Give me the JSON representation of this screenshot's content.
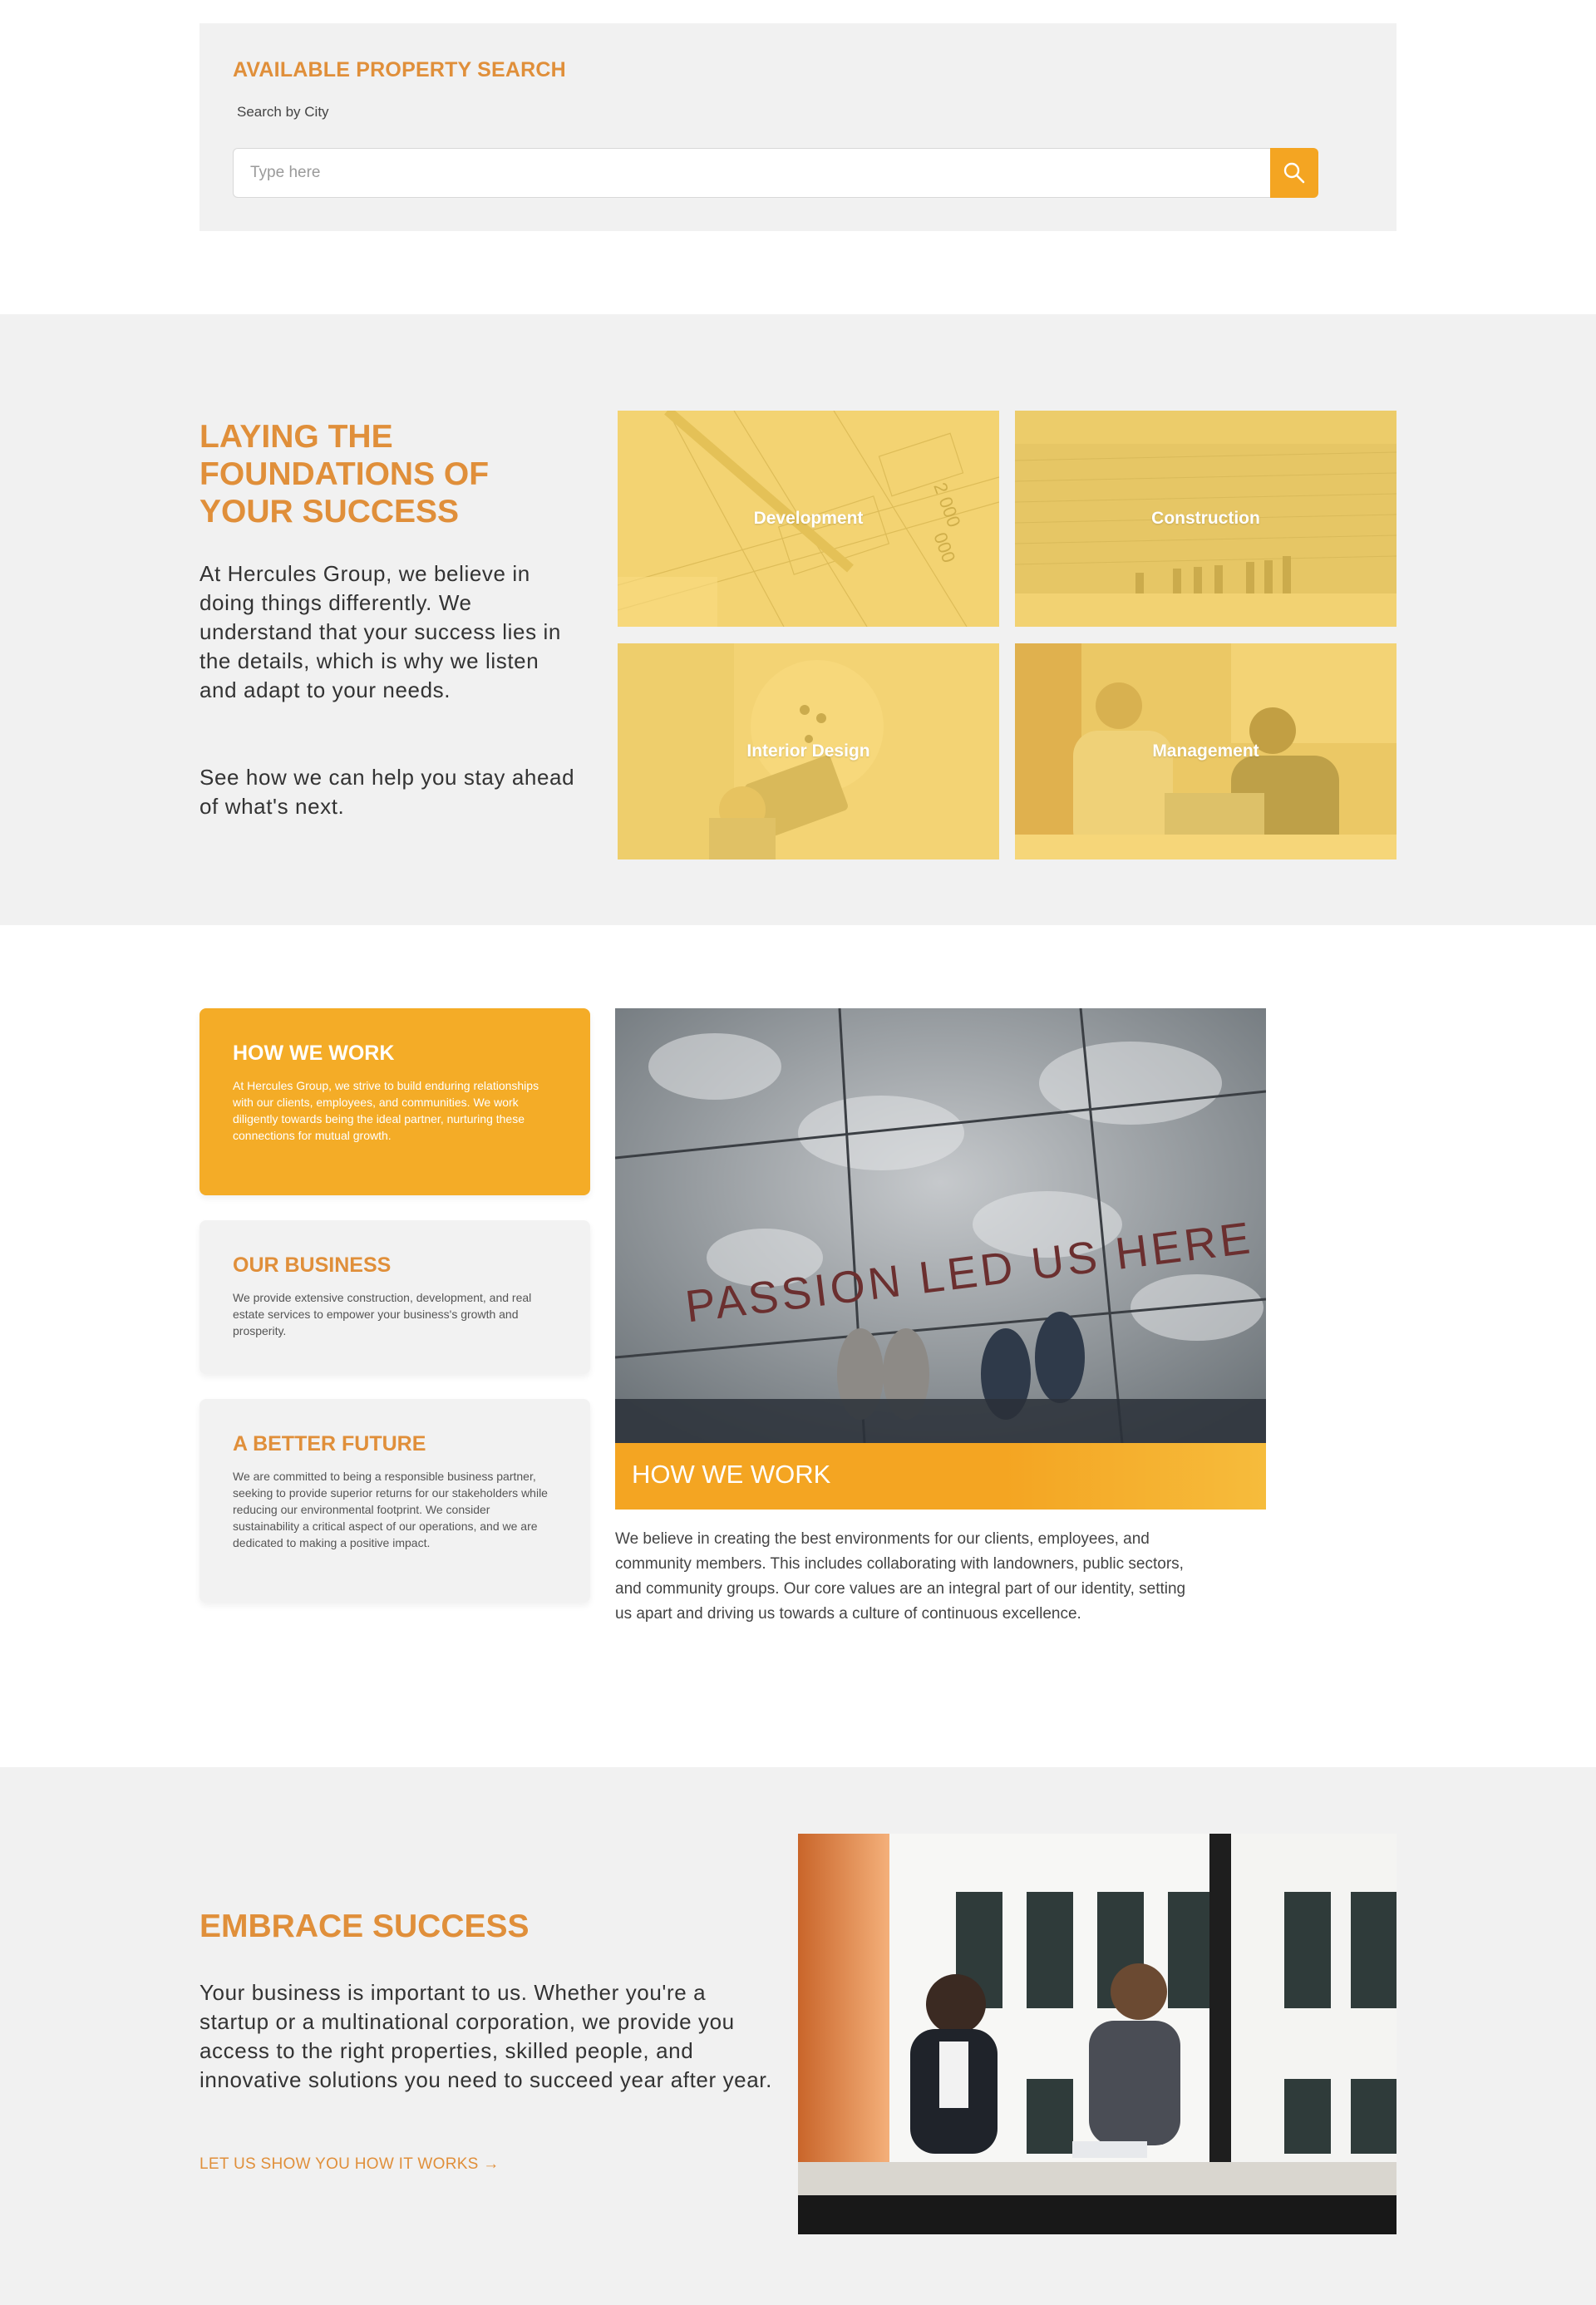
{
  "search": {
    "title": "AVAILABLE PROPERTY SEARCH",
    "label": "Search by City",
    "placeholder": "Type here",
    "button_icon": "search-icon"
  },
  "foundations": {
    "title": "LAYING THE FOUNDATIONS OF YOUR SUCCESS",
    "paragraph1": "At Hercules Group, we believe in doing things differently. We understand that your success lies in the details, which is why we listen and adapt to your needs.",
    "paragraph2": "See how we can help you stay ahead of what's next.",
    "tiles": [
      {
        "label": "Development"
      },
      {
        "label": "Construction"
      },
      {
        "label": "Interior Design"
      },
      {
        "label": "Management"
      }
    ]
  },
  "how": {
    "cards": [
      {
        "title": "HOW WE WORK",
        "text": "At Hercules Group, we strive to build enduring relationships with our clients, employees, and communities. We work diligently towards being the ideal partner, nurturing these connections for mutual growth."
      },
      {
        "title": "OUR BUSINESS",
        "text": "We provide extensive construction, development, and real estate services to empower your business's growth and prosperity."
      },
      {
        "title": "A BETTER FUTURE",
        "text": "We are committed to being a responsible business partner, seeking to provide superior returns for our stakeholders while reducing our environmental footprint. We consider sustainability a critical aspect of our operations, and we are dedicated to making a positive impact."
      }
    ],
    "photo_text": "PASSION LED US HERE",
    "caption": "HOW WE WORK",
    "description": "We believe in creating the best environments for our clients, employees, and community members. This includes collaborating with landowners, public sectors, and community groups. Our core values are an integral part of our identity, setting us apart and driving us towards a culture of continuous excellence."
  },
  "embrace": {
    "title": "EMBRACE SUCCESS",
    "paragraph": "Your business is important to us. Whether you're a startup or a multinational corporation, we provide you access to the right properties, skilled people, and innovative solutions you need to succeed year after year.",
    "link": "LET US SHOW YOU HOW IT WORKS",
    "link_icon": "arrow-right-icon"
  },
  "colors": {
    "accent": "#e08f3a",
    "brand_yellow": "#f4a522",
    "panel_gray": "#f1f1f1"
  }
}
